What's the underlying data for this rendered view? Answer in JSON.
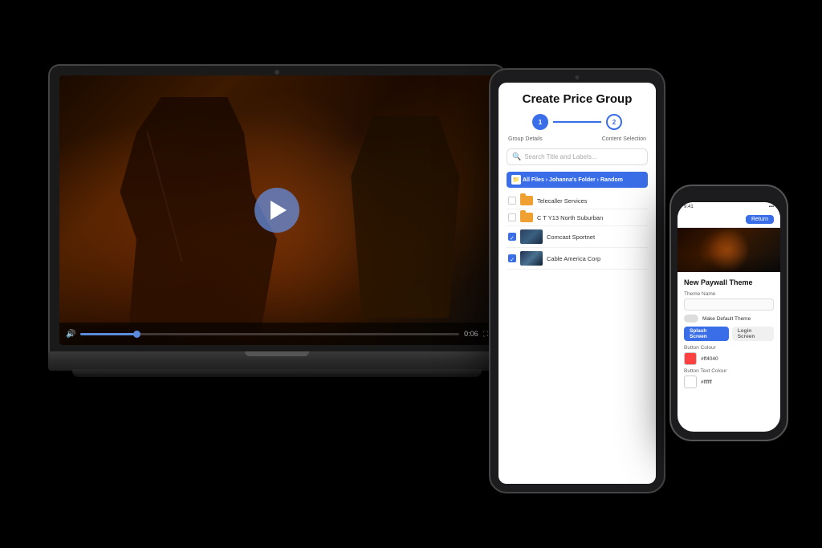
{
  "background": "#000000",
  "laptop": {
    "video": {
      "play_button_visible": true,
      "progress_time": "0:06",
      "progress_percent": 15
    }
  },
  "tablet": {
    "title": "Create Price Group",
    "stepper": {
      "step1_label": "Group Details",
      "step2_label": "Content Selection",
      "step1_number": "1",
      "step2_number": "2"
    },
    "search_placeholder": "Search Title and Labels...",
    "breadcrumb": "All Files › Johanna's Folder › Random",
    "files": [
      {
        "name": "Telecaller Services",
        "type": "folder",
        "checked": false
      },
      {
        "name": "C T Y13 North Suburban",
        "type": "folder",
        "checked": false
      },
      {
        "name": "Comcast Sportnet",
        "type": "video",
        "checked": true
      },
      {
        "name": "Cable America Corp",
        "type": "video",
        "checked": true
      }
    ]
  },
  "phone": {
    "status_bar": "9:41",
    "header_button": "Return",
    "section_title": "New Paywall Theme",
    "theme_name_label": "Theme Name",
    "theme_name_value": "",
    "default_toggle_label": "Make Default Theme",
    "tabs": [
      {
        "label": "Splash Screen",
        "active": true
      },
      {
        "label": "Login Screen",
        "active": false
      }
    ],
    "button_colour_label": "Button Colour",
    "button_colour_value": "#ff4040",
    "button_text_colour_label": "Button Text Colour",
    "button_text_colour_value": "#ffffff"
  }
}
